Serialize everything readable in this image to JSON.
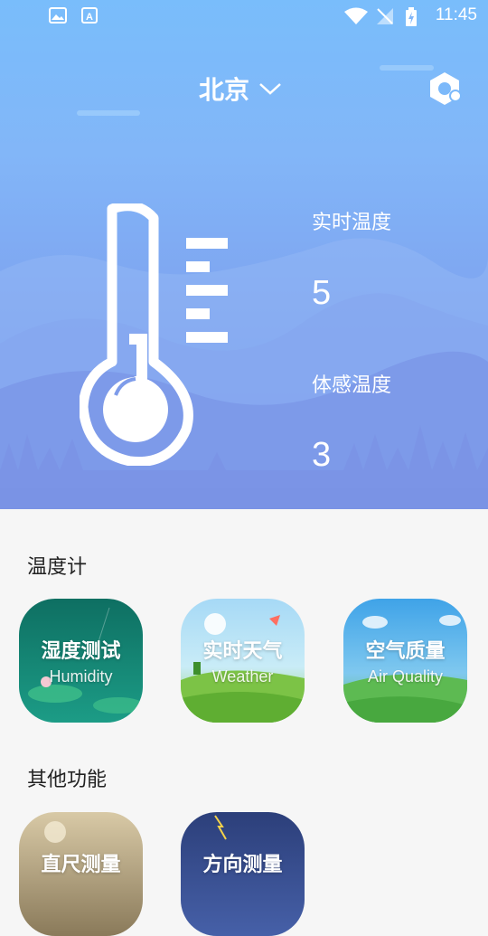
{
  "status_bar": {
    "time": "11:45"
  },
  "header": {
    "city": "北京"
  },
  "weather": {
    "realtime_label": "实时温度",
    "realtime_value": "5",
    "feels_label": "体感温度",
    "feels_value": "3"
  },
  "sections": {
    "thermometer_title": "温度计",
    "other_title": "其他功能"
  },
  "tiles": [
    {
      "cn": "湿度测试",
      "en": "Humidity"
    },
    {
      "cn": "实时天气",
      "en": "Weather"
    },
    {
      "cn": "空气质量",
      "en": "Air Quality"
    },
    {
      "cn": "直尺测量"
    },
    {
      "cn": "方向测量"
    }
  ]
}
